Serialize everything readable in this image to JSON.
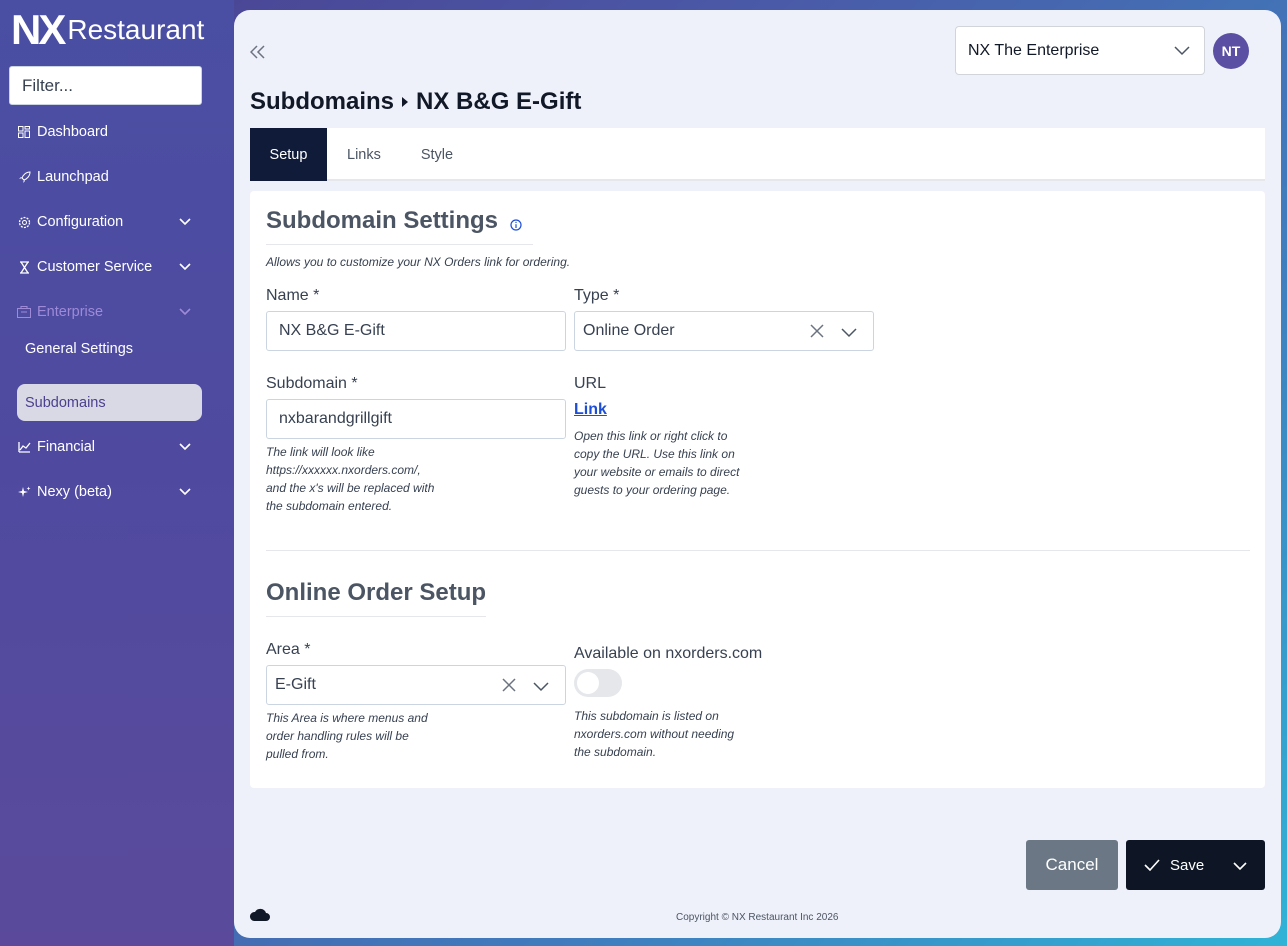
{
  "logo": {
    "mark": "NX",
    "text": "Restaurant"
  },
  "sidebar": {
    "filter_placeholder": "Filter...",
    "items": [
      {
        "label": "Dashboard",
        "icon": "dashboard-icon"
      },
      {
        "label": "Launchpad",
        "icon": "rocket-icon"
      },
      {
        "label": "Configuration",
        "icon": "gear-icon"
      },
      {
        "label": "Customer Service",
        "icon": "hourglass-icon"
      },
      {
        "label": "Enterprise",
        "icon": "building-icon"
      },
      {
        "label": "General Settings"
      },
      {
        "label": "Subdomains"
      },
      {
        "label": "Financial",
        "icon": "chart-icon"
      },
      {
        "label": "Nexy (beta)",
        "icon": "sparkle-icon"
      }
    ]
  },
  "header": {
    "enterprise_select": "NX The Enterprise",
    "avatar_initials": "NT",
    "breadcrumb": {
      "parent": "Subdomains",
      "current": "NX B&G E-Gift"
    }
  },
  "tabs": [
    {
      "label": "Setup"
    },
    {
      "label": "Links"
    },
    {
      "label": "Style"
    }
  ],
  "subdomain_settings": {
    "title": "Subdomain Settings",
    "description": "Allows you to customize your NX Orders link for ordering.",
    "name_label": "Name *",
    "name_value": "NX B&G E-Gift",
    "type_label": "Type *",
    "type_value": "Online Order",
    "subdomain_label": "Subdomain *",
    "subdomain_value": "nxbarandgrillgift",
    "subdomain_help": [
      "The link will look like",
      "https://xxxxxx.nxorders.com/,",
      "and the x's will be replaced with",
      "the subdomain entered."
    ],
    "url_label": "URL",
    "url_link": "Link",
    "url_help": [
      "Open this link or right click to",
      "copy the URL. Use this link on",
      "your website or emails to direct",
      "guests to your ordering page."
    ]
  },
  "online_order_setup": {
    "title": "Online Order Setup",
    "area_label": "Area *",
    "area_value": "E-Gift",
    "area_help": [
      "This Area is where menus and",
      "order handling rules will be",
      "pulled from."
    ],
    "available_label": "Available on nxorders.com",
    "available_on": false,
    "available_help": [
      "This subdomain is listed on",
      "nxorders.com without needing",
      "the subdomain."
    ]
  },
  "footer": {
    "cancel": "Cancel",
    "save": "Save",
    "copyright": "Copyright © NX Restaurant Inc 2026"
  },
  "colors": {
    "primary_dark": "#0f1b38",
    "accent_purple": "#5a4fa3",
    "link": "#1d4ed8"
  }
}
